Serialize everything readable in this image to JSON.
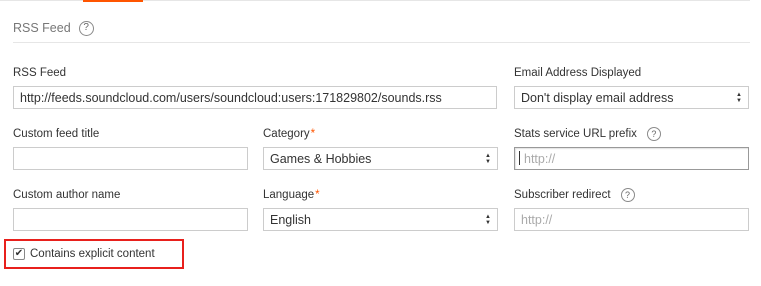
{
  "section": {
    "title": "RSS Feed",
    "help_glyph": "?"
  },
  "fields": {
    "rss_feed": {
      "label": "RSS Feed",
      "value": "http://feeds.soundcloud.com/users/soundcloud:users:171829802/sounds.rss"
    },
    "email_display": {
      "label": "Email Address Displayed",
      "selected": "Don't display email address"
    },
    "custom_feed_title": {
      "label": "Custom feed title",
      "value": ""
    },
    "category": {
      "label": "Category",
      "required_mark": "*",
      "selected": "Games & Hobbies"
    },
    "stats_prefix": {
      "label": "Stats service URL prefix",
      "placeholder": "http://",
      "help_glyph": "?"
    },
    "custom_author": {
      "label": "Custom author name",
      "value": ""
    },
    "language": {
      "label": "Language",
      "required_mark": "*",
      "selected": "English"
    },
    "subscriber_redirect": {
      "label": "Subscriber redirect",
      "placeholder": "http://",
      "help_glyph": "?"
    }
  },
  "explicit": {
    "label": "Contains explicit content",
    "checked": true,
    "check_glyph": "✔",
    "highlight_color": "#e8201c"
  },
  "colors": {
    "accent": "#ff5500"
  },
  "icons": {
    "help": "question-circle-icon",
    "select": "up-down-arrows-icon",
    "check": "checkmark-icon"
  }
}
